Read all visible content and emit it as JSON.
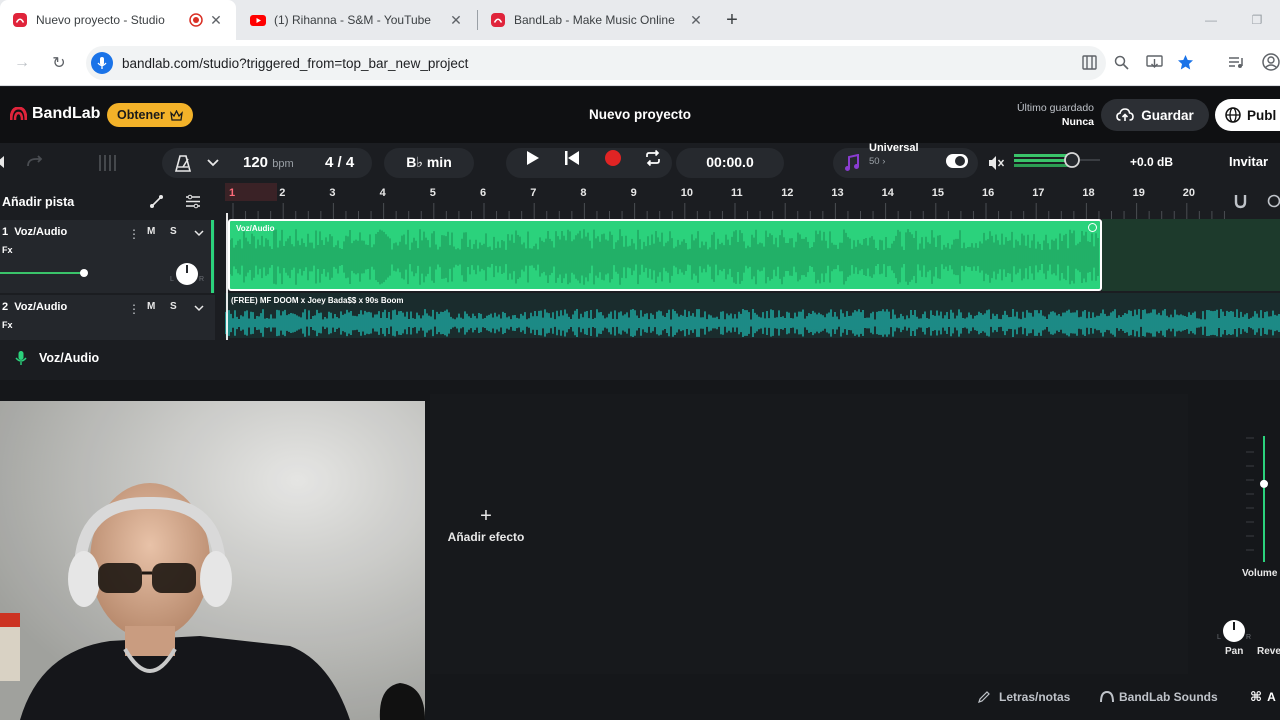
{
  "browser": {
    "tabs": [
      {
        "title": "Nuevo proyecto - Studio",
        "active": true
      },
      {
        "title": "(1) Rihanna - S&M - YouTube",
        "active": false
      },
      {
        "title": "BandLab - Make Music Online",
        "active": false
      }
    ],
    "new_tab_label": "+",
    "url": "bandlab.com/studio?triggered_from=top_bar_new_project"
  },
  "header": {
    "logo_text": "BandLab",
    "obtener_label": "Obtener",
    "project_title": "Nuevo proyecto",
    "saved_label": "Último guardado",
    "saved_value": "Nunca",
    "save_label": "Guardar",
    "publish_label": "Publ"
  },
  "toolbar": {
    "tempo": "120",
    "tempo_unit": "bpm",
    "time_sig_num": "4",
    "time_sig_sep": "/",
    "time_sig_den": "4",
    "key": "B♭ min",
    "time_display": "00:00.0",
    "preset_name": "Universal",
    "preset_sub": "50 ›",
    "master_db": "+0.0 dB",
    "invite_label": "Invitar"
  },
  "tracks_panel": {
    "add_track_label": "Añadir pista",
    "tracks": [
      {
        "number": "1",
        "name": "Voz/Audio",
        "fx": "Fx",
        "mute": "M",
        "solo": "S",
        "pan_l": "L",
        "pan_r": "R"
      },
      {
        "number": "2",
        "name": "Voz/Audio",
        "fx": "Fx",
        "mute": "M",
        "solo": "S"
      }
    ]
  },
  "ruler": {
    "bars": [
      "1",
      "2",
      "3",
      "4",
      "5",
      "6",
      "7",
      "8",
      "9",
      "10",
      "11",
      "12",
      "13",
      "14",
      "15",
      "16",
      "17",
      "18",
      "19",
      "20"
    ]
  },
  "clips": [
    {
      "label": "Voz/Audio",
      "color": "#2bd27c"
    },
    {
      "label": "(FREE) MF DOOM x Joey Bada$$ x 90s Boom",
      "color": "#1fc9c0"
    }
  ],
  "lower": {
    "selected_track": "Voz/Audio",
    "add_effect_label": "Añadir efecto",
    "add_effect_icon": "+",
    "volume_label": "Volume",
    "pan_label": "Pan",
    "reverb_label": "Reve",
    "pan_l": "L",
    "pan_r": "R",
    "volume_level": 0.62
  },
  "bottom_links": {
    "lyrics": "Letras/notas",
    "sounds": "BandLab Sounds",
    "shortcut_label": "A"
  },
  "colors": {
    "accent_green": "#2bd27c",
    "accent_teal": "#1fc9c0",
    "record_red": "#e02424",
    "obtener_yellow": "#f3b229"
  }
}
